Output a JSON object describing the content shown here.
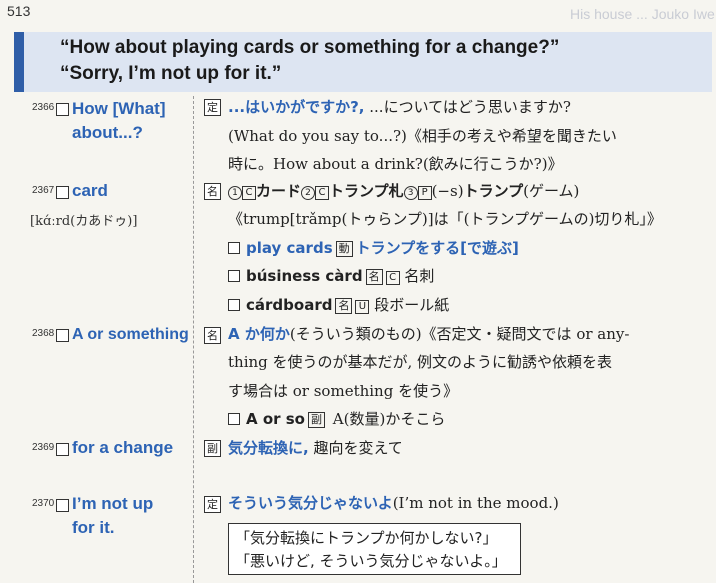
{
  "page_number": "513",
  "banner": {
    "line1": "“How about playing cards or something for a change?”",
    "line2": "“Sorry, I’m not up for it.”"
  },
  "entries": [
    {
      "num": "2366",
      "headword_line1": "How [What]",
      "headword_line2": "about...?",
      "badge": "定",
      "def_line1_bold": "...はいかがですか?,",
      "def_line1_rest": " ...についてはどう思いますか?",
      "def_line2": "(What do you say to...?)《相手の考えや希望を聞きたい",
      "def_line3": "時に。How about a drink?(飲みに行こうか?)》"
    },
    {
      "num": "2367",
      "headword": "card",
      "pron": "[kɑ́ːrd(カあドゥ)]",
      "badge": "名",
      "def_line1": {
        "n1": "1",
        "c1": "C",
        "t1": "カード",
        "n2": "2",
        "c2": "C",
        "t2": "トランプ札",
        "n3": "3",
        "p3": "P",
        "t3a": "(−s)",
        "t3b": "トランプ",
        "t3c": "(ゲーム)"
      },
      "def_line2": "《trump[trǎmp(トゥらンプ)]は「(トランプゲームの)切り札」》",
      "sub1": {
        "phrase": "play cards",
        "badge": "動",
        "meaning": "トランプをする[で遊ぶ]"
      },
      "sub2": {
        "phrase": "búsiness càrd",
        "badge": "名",
        "mark": "C",
        "meaning": "名刺"
      },
      "sub3": {
        "phrase": "cárdboard",
        "badge": "名",
        "mark": "U",
        "meaning": "段ボール紙"
      }
    },
    {
      "num": "2368",
      "headword": "A or something",
      "badge": "名",
      "def_line1_bold": "A か何か",
      "def_line1_rest": "(そういう類のもの)《否定文・疑問文では or  any-",
      "def_line2": "thing を使うのが基本だが, 例文のように勧誘や依頼を表",
      "def_line3": "す場合は or something を使う》",
      "sub1": {
        "phrase": "A or so",
        "badge": "副",
        "meaning": "A(数量)かそこら"
      }
    },
    {
      "num": "2369",
      "headword": "for a change",
      "badge": "副",
      "def_bold": "気分転換に,",
      "def_rest": " 趣向を変えて"
    },
    {
      "num": "2370",
      "headword_line1": "I’m not up",
      "headword_line2": "for it.",
      "badge": "定",
      "def_bold": "そういう気分じゃないよ",
      "def_rest": "(I’m not in the mood.)",
      "dialog_line1": "「気分転換にトランプか何かしない?」",
      "dialog_line2": "「悪いけど, そういう気分じゃないよ。」"
    }
  ]
}
